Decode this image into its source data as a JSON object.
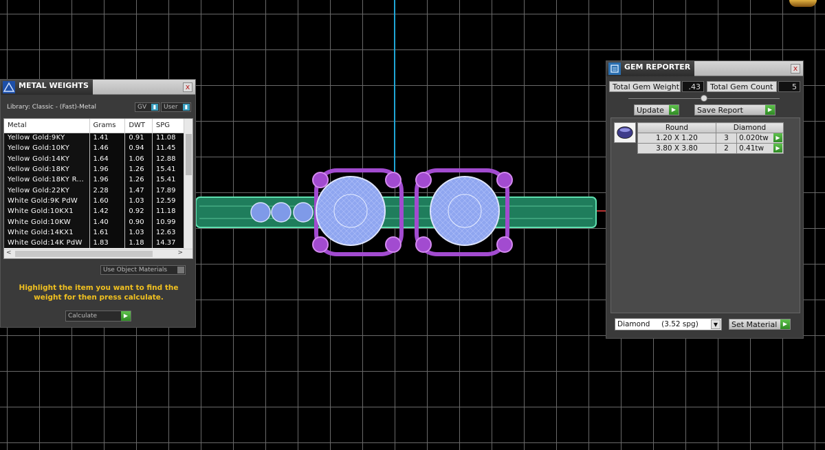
{
  "metal_weights": {
    "title": "METAL WEIGHTS",
    "close_symbol": "x",
    "library_label": "Library: Classic - (Fast)-Metal",
    "gv_label": "GV",
    "user_label": "User",
    "columns": [
      "Metal",
      "Grams",
      "DWT",
      "SPG"
    ],
    "rows": [
      [
        "Yellow Gold:9KY",
        "1.41",
        "0.91",
        "11.08"
      ],
      [
        "Yellow Gold:10KY",
        "1.46",
        "0.94",
        "11.45"
      ],
      [
        "Yellow Gold:14KY",
        "1.64",
        "1.06",
        "12.88"
      ],
      [
        "Yellow Gold:18KY",
        "1.96",
        "1.26",
        "15.41"
      ],
      [
        "Yellow Gold:18KY R...",
        "1.96",
        "1.26",
        "15.41"
      ],
      [
        "Yellow Gold:22KY",
        "2.28",
        "1.47",
        "17.89"
      ],
      [
        "White Gold:9K PdW",
        "1.60",
        "1.03",
        "12.59"
      ],
      [
        "White Gold:10KX1",
        "1.42",
        "0.92",
        "11.18"
      ],
      [
        "White Gold:10KW",
        "1.40",
        "0.90",
        "10.99"
      ],
      [
        "White Gold:14KX1",
        "1.61",
        "1.03",
        "12.63"
      ],
      [
        "White Gold:14K PdW",
        "1.83",
        "1.18",
        "14.37"
      ]
    ],
    "scroll_left": "<",
    "scroll_right": ">",
    "use_object_materials": "Use Object Materials",
    "instruction": "Highlight the item you want to find the weight for then press calculate.",
    "calculate_label": "Calculate"
  },
  "gem_reporter": {
    "title": "GEM REPORTER",
    "close_symbol": "x",
    "total_weight_label": "Total Gem Weight",
    "total_weight_value": ".43",
    "total_count_label": "Total Gem Count",
    "total_count_value": "5",
    "update_label": "Update",
    "save_report_label": "Save Report",
    "table_headers": [
      "Round",
      "Diamond"
    ],
    "rows": [
      {
        "size": "1.20 X 1.20",
        "count": "3",
        "weight": "0.020tw"
      },
      {
        "size": "3.80 X 3.80",
        "count": "2",
        "weight": "0.41tw"
      }
    ],
    "material_value": "Diamond     (3.52 spg)",
    "set_material_label": "Set Material"
  },
  "icons": {
    "go_arrow": "▶",
    "dropdown": "▼",
    "tick": "▮"
  },
  "colors": {
    "band": "#2fa37a",
    "gems": "#7f9ae8",
    "prongs": "#a24bd0",
    "axis_blue": "#1fa6d6",
    "instruction": "#f0c020"
  }
}
